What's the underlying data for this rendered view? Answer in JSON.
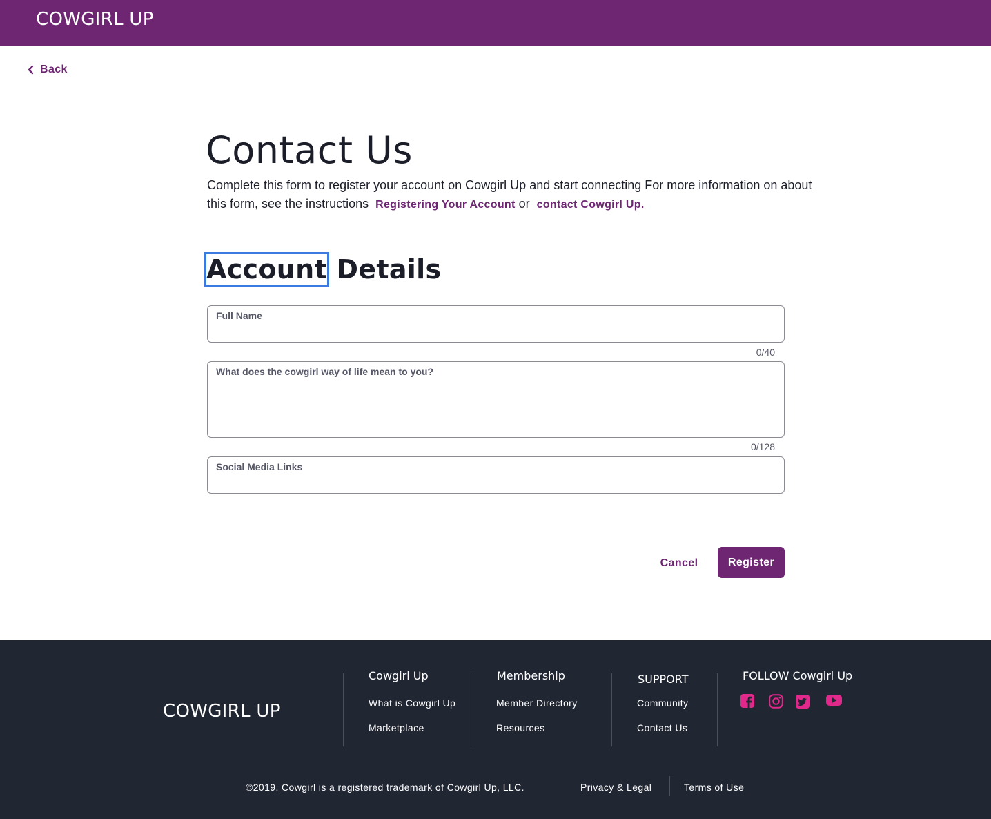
{
  "header": {
    "brand": "COWGIRL UP",
    "brand_color": "#6e2673"
  },
  "nav": {
    "back_label": "Back"
  },
  "page": {
    "title": "Contact Us",
    "intro_text": "Complete this form to register your account on Cowgirl Up and start connecting For more information on about this form, see the instructions",
    "link_registering": "Registering Your Account",
    "or_text": "or",
    "link_contact": "contact Cowgirl Up",
    "period": "."
  },
  "form": {
    "section_title_highlight": "Account",
    "section_title_rest": " Details",
    "full_name": {
      "label": "Full Name",
      "value": "",
      "counter": "0/40"
    },
    "cowgirl_way": {
      "label": "What does the cowgirl way of life mean to you?",
      "value": "",
      "counter": "0/128"
    },
    "social_links": {
      "label": "Social Media Links",
      "value": ""
    },
    "cancel_label": "Cancel",
    "register_label": "Register"
  },
  "footer": {
    "brand": "COWGIRL UP",
    "columns": [
      {
        "title": "Cowgirl Up",
        "links": [
          "What is Cowgirl Up",
          "Marketplace"
        ]
      },
      {
        "title": "Membership",
        "links": [
          "Member Directory",
          "Resources"
        ]
      },
      {
        "title": "SUPPORT",
        "links": [
          "Community",
          "Contact Us"
        ]
      }
    ],
    "follow_title": "FOLLOW Cowgirl Up",
    "social_icons": [
      "facebook-icon",
      "instagram-icon",
      "twitter-icon",
      "youtube-icon"
    ],
    "social_color": "#e0298a",
    "copyright": "©2019. Cowgirl is a registered trademark of Cowgirl Up, LLC.",
    "privacy_label": "Privacy & Legal",
    "terms_label": "Terms of Use",
    "background": "#212633"
  }
}
